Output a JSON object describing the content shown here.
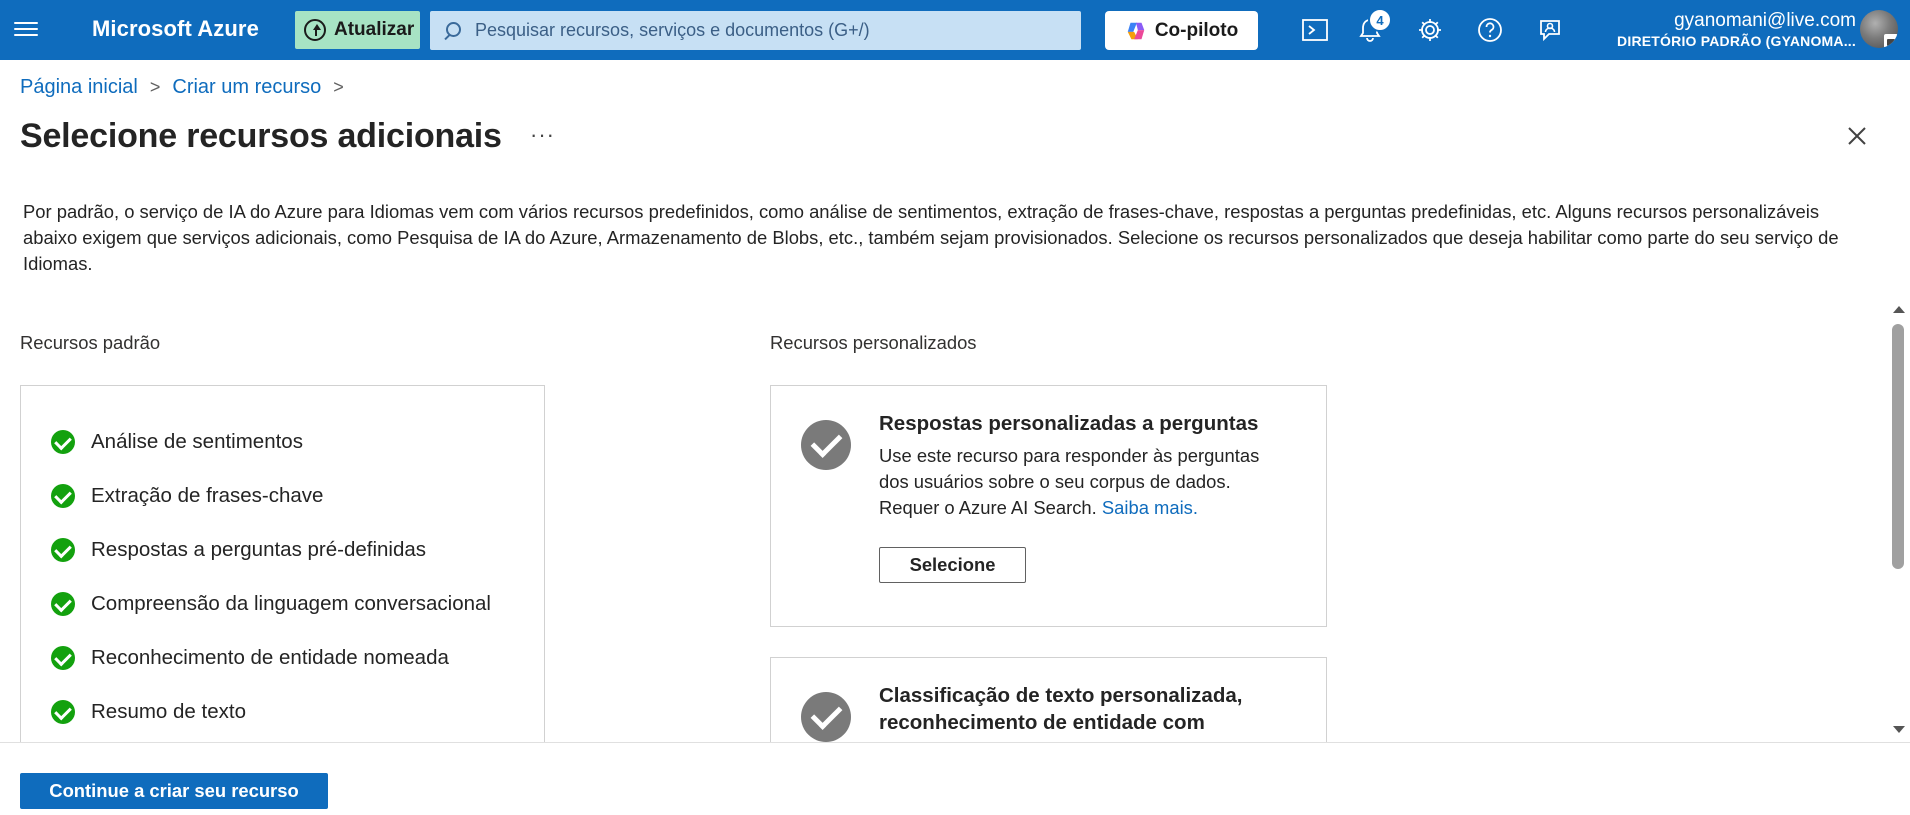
{
  "topbar": {
    "brand": "Microsoft Azure",
    "update_label": "Atualizar",
    "search_placeholder": "Pesquisar recursos, serviços e documentos (G+/)",
    "copilot_label": "Co-piloto",
    "notifications_count": "4",
    "account_email": "gyanomani@live.com",
    "account_directory": "DIRETÓRIO PADRÃO (GYANOMA..."
  },
  "breadcrumb": {
    "home": "Página inicial",
    "create": "Criar um recurso",
    "separator": ">"
  },
  "page": {
    "title": "Selecione recursos adicionais",
    "more": "···",
    "description": "Por padrão, o serviço de IA do Azure para Idiomas vem com vários recursos predefinidos, como análise de sentimentos, extração de frases-chave, respostas a perguntas predefinidas, etc. Alguns recursos personalizáveis abaixo exigem que serviços adicionais, como Pesquisa de IA do Azure, Armazenamento de Blobs, etc., também sejam provisionados. Selecione os recursos personalizados que deseja habilitar como parte do seu serviço de Idiomas."
  },
  "default_features": {
    "label": "Recursos padrão",
    "items": [
      "Análise de sentimentos",
      "Extração de frases-chave",
      "Respostas a perguntas pré-definidas",
      "Compreensão da linguagem conversacional",
      "Reconhecimento de entidade nomeada",
      "Resumo de texto"
    ]
  },
  "custom_features": {
    "label": "Recursos personalizados",
    "cards": [
      {
        "title": "Respostas personalizadas a perguntas",
        "description": "Use este recurso para responder às perguntas dos usuários sobre o seu corpus de dados. Requer o Azure AI Search.",
        "link": "Saiba mais.",
        "button": "Selecione"
      },
      {
        "title_line1": "Classificação de texto personalizada,",
        "title_line2": "reconhecimento de entidade com"
      }
    ]
  },
  "footer": {
    "primary_button": "Continue a criar seu recurso"
  },
  "colors": {
    "topbar": "#0f6cbd",
    "update_button": "#a7e3c4",
    "search_box": "#c7e0f4",
    "link": "#0f6cbd",
    "default_check": "#13a10e",
    "custom_check": "#7a7a7a"
  }
}
